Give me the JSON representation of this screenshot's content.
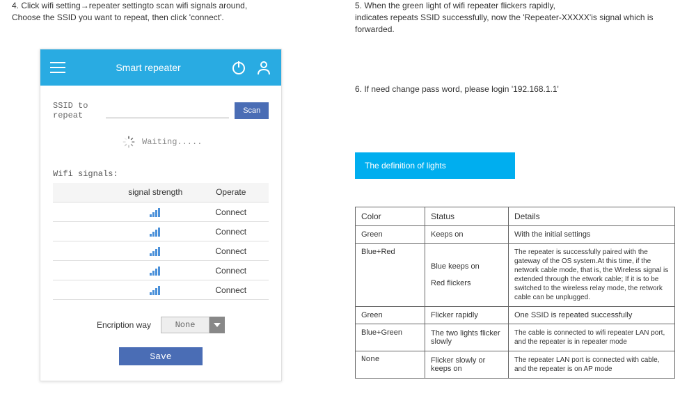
{
  "left": {
    "step4_line1": "4. Click wifi setting→repeater settingto scan wifi signals around,",
    "step4_line2": "Choose the SSID you want to repeat, then click 'connect'."
  },
  "right": {
    "step5_line1": "5. When the green light of wifi repeater flickers rapidly,",
    "step5_line2": "indicates repeats SSID successfully, now the 'Repeater-XXXXX'is signal which is forwarded.",
    "step6": "6. If need change pass word, please login '192.168.1.1'",
    "def_title": "The definition of lights"
  },
  "phone": {
    "title": "Smart repeater",
    "ssid_label": "SSID to repeat",
    "scan": "Scan",
    "waiting": "Waiting.....",
    "signals_label": "Wifi signals:",
    "table": {
      "h1": "",
      "h2": "signal strength",
      "h3": "Operate",
      "connect": "Connect"
    },
    "encrypt_label": "Encription way",
    "encrypt_value": "None",
    "save": "Save"
  },
  "lights": {
    "h1": "Color",
    "h2": "Status",
    "h3": "Details",
    "rows": [
      {
        "color": "Green",
        "status": "Keeps on",
        "details": "With the initial settings"
      },
      {
        "color": "Blue+Red",
        "status": "Blue keeps on\n\nRed flickers",
        "details": "The repeater is successfully paired with the gateway of the OS system.At this time, if the network cable mode, that is, the Wireless signal is extended through the etwork cable; If it is to be switched to the wireless relay mode, the retwork cable can be unplugged."
      },
      {
        "color": "Green",
        "status": "Flicker rapidly",
        "details": "One SSID is repeated successfully"
      },
      {
        "color": "Blue+Green",
        "status": "The two lights flicker slowly",
        "details": "The cable is connected to wifi repeater LAN port, and the repeater is in repeater mode"
      },
      {
        "color": "None",
        "status": "Flicker slowly or keeps on",
        "details": "The repeater LAN port is connected with cable, and the repeater is on AP mode"
      }
    ]
  }
}
